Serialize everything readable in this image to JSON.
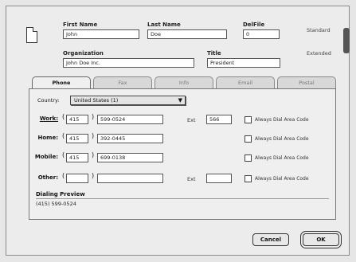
{
  "header": {
    "first_name_label": "First Name",
    "first_name_value": "John",
    "last_name_label": "Last Name",
    "last_name_value": "Doe",
    "delfile_label": "DelFile",
    "delfile_value": "0",
    "organization_label": "Organization",
    "organization_value": "John Doe Inc.",
    "title_label": "Title",
    "title_value": "President",
    "view_standard": "Standard",
    "view_extended": "Extended"
  },
  "tabs": [
    {
      "label": "Phone",
      "active": true
    },
    {
      "label": "Fax",
      "active": false
    },
    {
      "label": "Info",
      "active": false
    },
    {
      "label": "Email",
      "active": false
    },
    {
      "label": "Postal",
      "active": false
    }
  ],
  "phone": {
    "country_label": "Country:",
    "country_value": "United States (1)",
    "rows": [
      {
        "label": "Work:",
        "area": "415",
        "number": "599-0524",
        "ext_label": "Ext",
        "ext": "566",
        "checkbox_label": "Always Dial Area Code"
      },
      {
        "label": "Home:",
        "area": "415",
        "number": "392-0445",
        "checkbox_label": "Always Dial Area Code"
      },
      {
        "label": "Mobile:",
        "area": "415",
        "number": "699-0138",
        "checkbox_label": "Always Dial Area Code"
      },
      {
        "label": "Other:",
        "area": "",
        "number": "",
        "ext_label": "Ext",
        "ext": "",
        "checkbox_label": "Always Dial Area Code"
      }
    ],
    "preview_title": "Dialing Preview",
    "preview_value": "(415) 599-0524"
  },
  "buttons": {
    "cancel": "Cancel",
    "ok": "OK"
  }
}
